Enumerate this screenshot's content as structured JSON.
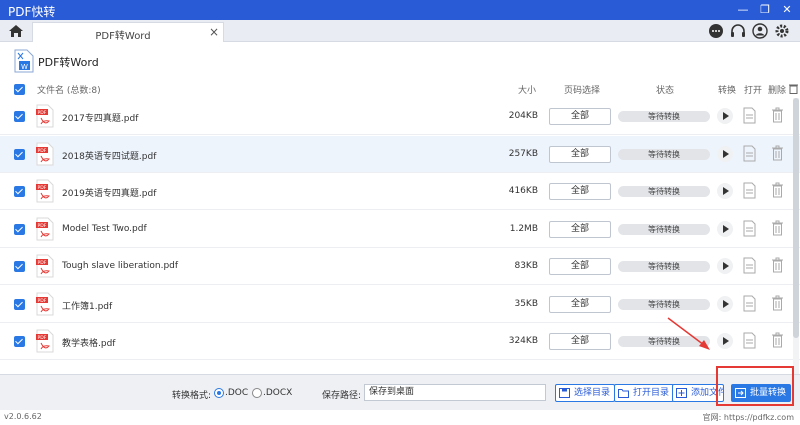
{
  "app": {
    "title": "PDF快转",
    "accent": "#2a78e4",
    "titlebar_color": "#2a5bd7"
  },
  "window": {
    "minimize": "—",
    "restore": "❐",
    "close": "✕"
  },
  "tab": {
    "label": "PDF转Word",
    "close": "×"
  },
  "toolbar_icons": [
    "chat-icon",
    "headset-icon",
    "user-icon",
    "gear-icon"
  ],
  "page": {
    "title": "PDF转Word"
  },
  "table": {
    "headers": {
      "filename": "文件名 (总数:8)",
      "size": "大小",
      "pages": "页码选择",
      "status": "状态",
      "convert": "转换",
      "open": "打开",
      "delete": "删除"
    },
    "rows": [
      {
        "name": "2017专四真题.pdf",
        "size": "204KB",
        "pages": "全部",
        "status": "等待转换"
      },
      {
        "name": "2018英语专四试题.pdf",
        "size": "257KB",
        "pages": "全部",
        "status": "等待转换",
        "selected": true
      },
      {
        "name": "2019英语专四真题.pdf",
        "size": "416KB",
        "pages": "全部",
        "status": "等待转换"
      },
      {
        "name": "Model Test Two.pdf",
        "size": "1.2MB",
        "pages": "全部",
        "status": "等待转换"
      },
      {
        "name": "Tough slave liberation.pdf",
        "size": "83KB",
        "pages": "全部",
        "status": "等待转换"
      },
      {
        "name": "工作簿1.pdf",
        "size": "35KB",
        "pages": "全部",
        "status": "等待转换"
      },
      {
        "name": "教学表格.pdf",
        "size": "324KB",
        "pages": "全部",
        "status": "等待转换"
      }
    ]
  },
  "bottom": {
    "format_label": "转换格式:",
    "format_doc": ".DOC",
    "format_docx": ".DOCX",
    "save_label": "保存路径:",
    "save_value": "保存到桌面",
    "choose_dir": "选择目录",
    "open_dir": "打开目录",
    "add_file": "添加文件",
    "batch": "批量转换"
  },
  "footer": {
    "version": "v2.0.6.62",
    "site": "官网: https://pdfkz.com"
  }
}
